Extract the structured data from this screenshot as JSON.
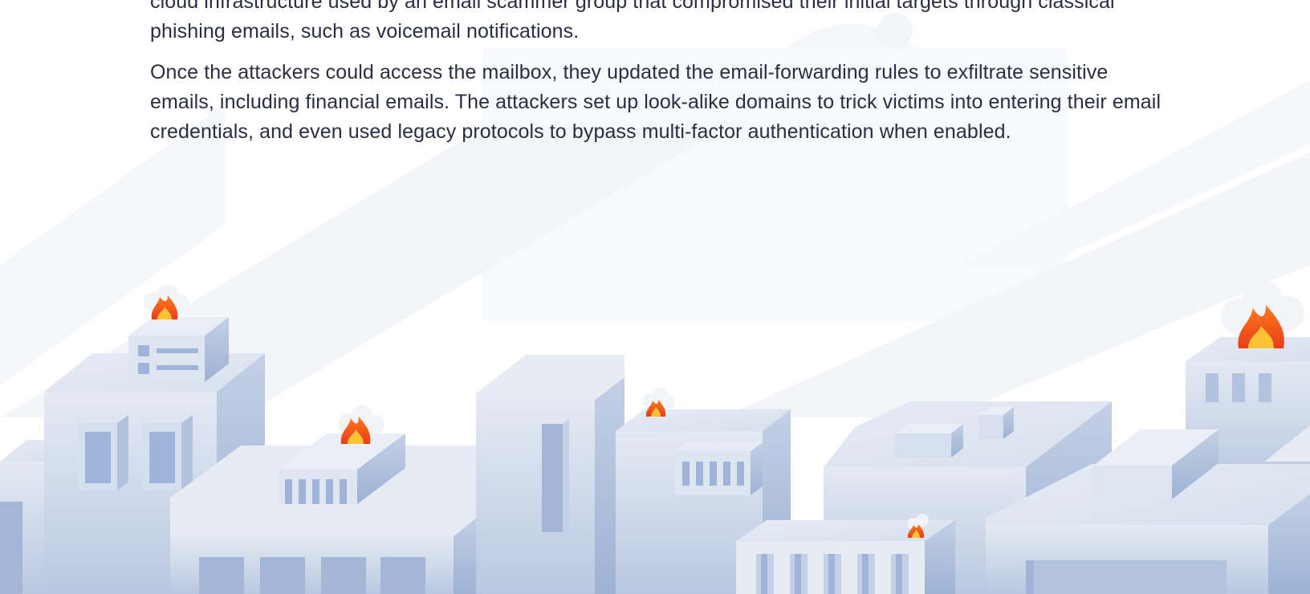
{
  "article": {
    "paragraph_1": "cloud infrastructure used by an email scammer group that compromised their initial targets through classical phishing emails, such as voicemail notifications.",
    "paragraph_2": "Once the attackers could access the mailbox, they updated the email-forwarding rules to exfiltrate sensitive emails, including financial emails. The attackers set up look-alike domains to trick victims into entering their email credentials, and even used legacy protocols to bypass multi-factor authentication when enabled."
  },
  "illustration": {
    "theme": "isometric city buildings on fire",
    "colors": {
      "building_light": "#e3e9f3",
      "building_mid": "#c4d1e6",
      "building_dark": "#a3b6d6",
      "window": "#9fb4d8",
      "flame_outer": "#f15a1f",
      "flame_inner": "#ffc233",
      "smoke": "#f2f4f8"
    }
  }
}
